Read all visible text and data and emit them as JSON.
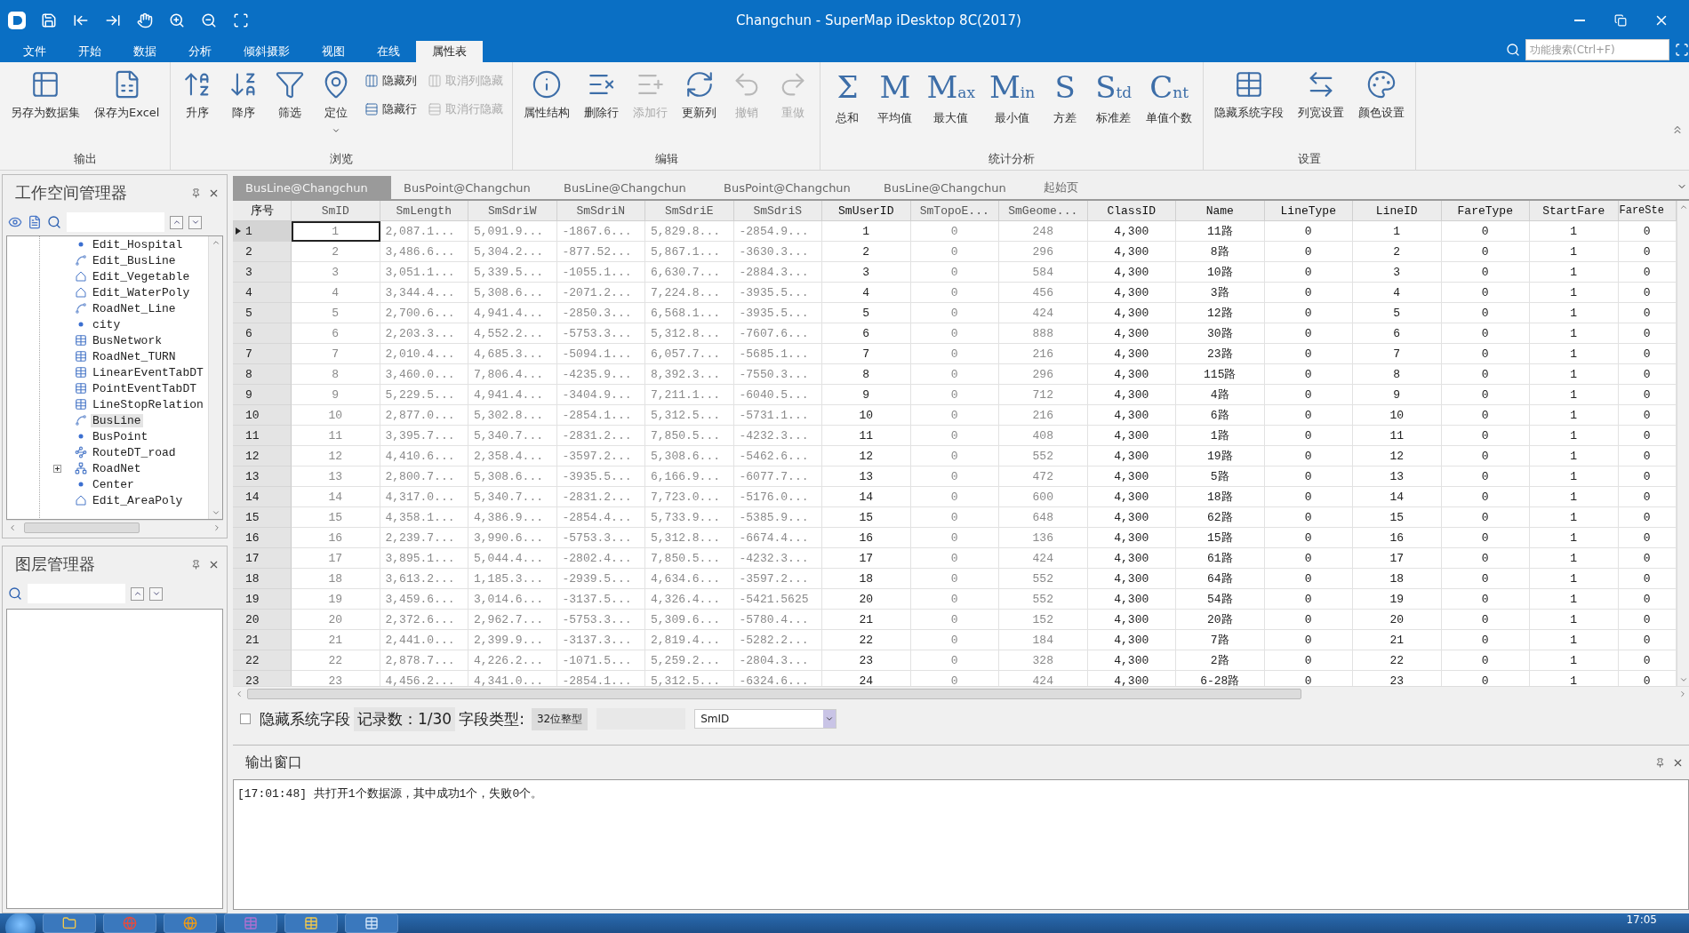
{
  "title_bar": {
    "title": "Changchun - SuperMap iDesktop 8C(2017)"
  },
  "menu_tabs": [
    {
      "label": "文件",
      "selected": false
    },
    {
      "label": "开始",
      "selected": false
    },
    {
      "label": "数据",
      "selected": false
    },
    {
      "label": "分析",
      "selected": false
    },
    {
      "label": "倾斜摄影",
      "selected": false
    },
    {
      "label": "视图",
      "selected": false
    },
    {
      "label": "在线",
      "selected": false
    },
    {
      "label": "属性表",
      "selected": true
    }
  ],
  "search": {
    "placeholder": "功能搜索(Ctrl+F)"
  },
  "ribbon": {
    "groups": [
      {
        "title": "输出",
        "buttons": [
          {
            "kind": "large",
            "label": "另存为数据集",
            "disabled": false
          },
          {
            "kind": "large",
            "label": "保存为Excel",
            "disabled": false
          }
        ]
      },
      {
        "title": "浏览",
        "buttons": [
          {
            "kind": "large",
            "label": "升序",
            "disabled": false
          },
          {
            "kind": "large",
            "label": "降序",
            "disabled": false
          },
          {
            "kind": "large",
            "label": "筛选",
            "disabled": false
          },
          {
            "kind": "large",
            "label": "定位",
            "disabled": false,
            "dropdown": true
          },
          {
            "kind": "small",
            "label": "隐藏列",
            "disabled": false
          },
          {
            "kind": "small",
            "label": "隐藏行",
            "disabled": false
          },
          {
            "kind": "small",
            "label": "取消列隐藏",
            "disabled": true
          },
          {
            "kind": "small",
            "label": "取消行隐藏",
            "disabled": true
          }
        ]
      },
      {
        "title": "编辑",
        "buttons": [
          {
            "kind": "large",
            "label": "属性结构",
            "disabled": false
          },
          {
            "kind": "large",
            "label": "删除行",
            "disabled": false
          },
          {
            "kind": "large",
            "label": "添加行",
            "disabled": true
          },
          {
            "kind": "large",
            "label": "更新列",
            "disabled": false
          },
          {
            "kind": "large",
            "label": "撤销",
            "disabled": true
          },
          {
            "kind": "large",
            "label": "重做",
            "disabled": true
          }
        ]
      },
      {
        "title": "统计分析",
        "buttons": [
          {
            "kind": "stat",
            "glyph": "Σ",
            "label": "总和",
            "disabled": false
          },
          {
            "kind": "stat",
            "glyph": "M",
            "label": "平均值",
            "disabled": false
          },
          {
            "kind": "stat",
            "glyph": "M",
            "sub": "ax",
            "label": "最大值",
            "disabled": false
          },
          {
            "kind": "stat",
            "glyph": "M",
            "sub": "in",
            "label": "最小值",
            "disabled": false
          },
          {
            "kind": "stat",
            "glyph": "S",
            "label": "方差",
            "disabled": false
          },
          {
            "kind": "stat",
            "glyph": "S",
            "sub": "td",
            "label": "标准差",
            "disabled": false
          },
          {
            "kind": "stat",
            "glyph": "C",
            "sub": "nt",
            "label": "单值个数",
            "disabled": false
          }
        ]
      },
      {
        "title": "设置",
        "buttons": [
          {
            "kind": "large",
            "label": "隐藏系统字段",
            "disabled": false
          },
          {
            "kind": "large",
            "label": "列宽设置",
            "disabled": false
          },
          {
            "kind": "large",
            "label": "颜色设置",
            "disabled": false
          }
        ]
      }
    ]
  },
  "workspace": {
    "title": "工作空间管理器",
    "tree": [
      {
        "label": "Edit_Hospital",
        "kind": "point",
        "selected": false
      },
      {
        "label": "Edit_BusLine",
        "kind": "line",
        "selected": false
      },
      {
        "label": "Edit_Vegetable",
        "kind": "region",
        "selected": false
      },
      {
        "label": "Edit_WaterPoly",
        "kind": "region",
        "selected": false
      },
      {
        "label": "RoadNet_Line",
        "kind": "line",
        "selected": false
      },
      {
        "label": "city",
        "kind": "point",
        "selected": false
      },
      {
        "label": "BusNetwork",
        "kind": "table",
        "selected": false
      },
      {
        "label": "RoadNet_TURN",
        "kind": "table",
        "selected": false
      },
      {
        "label": "LinearEventTabDT",
        "kind": "table",
        "selected": false
      },
      {
        "label": "PointEventTabDT",
        "kind": "table",
        "selected": false
      },
      {
        "label": "LineStopRelation",
        "kind": "table",
        "selected": false
      },
      {
        "label": "BusLine",
        "kind": "line",
        "selected": true
      },
      {
        "label": "BusPoint",
        "kind": "point",
        "selected": false
      },
      {
        "label": "RouteDT_road",
        "kind": "route",
        "selected": false
      },
      {
        "label": "RoadNet",
        "kind": "network",
        "selected": false,
        "expanded": false
      },
      {
        "label": "Center",
        "kind": "point",
        "selected": false
      },
      {
        "label": "Edit_AreaPoly",
        "kind": "region",
        "selected": false
      }
    ]
  },
  "layers": {
    "title": "图层管理器"
  },
  "doc_tabs": [
    {
      "label": "BusLine@Changchun",
      "selected": true
    },
    {
      "label": "BusPoint@Changchun",
      "selected": false
    },
    {
      "label": "BusLine@Changchun",
      "selected": false
    },
    {
      "label": "BusPoint@Changchun",
      "selected": false
    },
    {
      "label": "BusLine@Changchun",
      "selected": false
    },
    {
      "label": "起始页",
      "selected": false
    }
  ],
  "table": {
    "columns": [
      {
        "label": "序号"
      },
      {
        "label": "SmID",
        "system": true
      },
      {
        "label": "SmLength",
        "system": true
      },
      {
        "label": "SmSdriW",
        "system": true
      },
      {
        "label": "SmSdriN",
        "system": true
      },
      {
        "label": "SmSdriE",
        "system": true
      },
      {
        "label": "SmSdriS",
        "system": true
      },
      {
        "label": "SmUserID",
        "system": false
      },
      {
        "label": "SmTopoE...",
        "system": true
      },
      {
        "label": "SmGeome...",
        "system": true
      },
      {
        "label": "ClassID",
        "system": false
      },
      {
        "label": "Name",
        "system": false
      },
      {
        "label": "LineType",
        "system": false
      },
      {
        "label": "LineID",
        "system": false
      },
      {
        "label": "FareType",
        "system": false
      },
      {
        "label": "StartFare",
        "system": false
      },
      {
        "label": "FareSte",
        "system": false
      }
    ],
    "rows": [
      {
        "selected": true,
        "cells": [
          "1",
          "1",
          "2,087.1...",
          "5,091.9...",
          "-1867.6...",
          "5,829.8...",
          "-2854.9...",
          "1",
          "0",
          "248",
          "4,300",
          "11路",
          "0",
          "1",
          "0",
          "1",
          "0"
        ]
      },
      {
        "selected": false,
        "cells": [
          "2",
          "2",
          "3,486.6...",
          "5,304.2...",
          "-877.52...",
          "5,867.1...",
          "-3630.3...",
          "2",
          "0",
          "296",
          "4,300",
          "8路",
          "0",
          "2",
          "0",
          "1",
          "0"
        ]
      },
      {
        "selected": false,
        "cells": [
          "3",
          "3",
          "3,051.1...",
          "5,339.5...",
          "-1055.1...",
          "6,630.7...",
          "-2884.3...",
          "3",
          "0",
          "584",
          "4,300",
          "10路",
          "0",
          "3",
          "0",
          "1",
          "0"
        ]
      },
      {
        "selected": false,
        "cells": [
          "4",
          "4",
          "3,344.4...",
          "5,308.6...",
          "-2071.2...",
          "7,224.8...",
          "-3935.5...",
          "4",
          "0",
          "456",
          "4,300",
          "3路",
          "0",
          "4",
          "0",
          "1",
          "0"
        ]
      },
      {
        "selected": false,
        "cells": [
          "5",
          "5",
          "2,700.6...",
          "4,941.4...",
          "-2850.3...",
          "6,568.1...",
          "-3935.5...",
          "5",
          "0",
          "424",
          "4,300",
          "12路",
          "0",
          "5",
          "0",
          "1",
          "0"
        ]
      },
      {
        "selected": false,
        "cells": [
          "6",
          "6",
          "2,203.3...",
          "4,552.2...",
          "-5753.3...",
          "5,312.8...",
          "-7607.6...",
          "6",
          "0",
          "888",
          "4,300",
          "30路",
          "0",
          "6",
          "0",
          "1",
          "0"
        ]
      },
      {
        "selected": false,
        "cells": [
          "7",
          "7",
          "2,010.4...",
          "4,685.3...",
          "-5094.1...",
          "6,057.7...",
          "-5685.1...",
          "7",
          "0",
          "216",
          "4,300",
          "23路",
          "0",
          "7",
          "0",
          "1",
          "0"
        ]
      },
      {
        "selected": false,
        "cells": [
          "8",
          "8",
          "3,460.0...",
          "7,806.4...",
          "-4235.9...",
          "8,392.3...",
          "-7550.3...",
          "8",
          "0",
          "296",
          "4,300",
          "115路",
          "0",
          "8",
          "0",
          "1",
          "0"
        ]
      },
      {
        "selected": false,
        "cells": [
          "9",
          "9",
          "5,229.5...",
          "4,941.4...",
          "-3404.9...",
          "7,211.1...",
          "-6040.5...",
          "9",
          "0",
          "712",
          "4,300",
          "4路",
          "0",
          "9",
          "0",
          "1",
          "0"
        ]
      },
      {
        "selected": false,
        "cells": [
          "10",
          "10",
          "2,877.0...",
          "5,302.8...",
          "-2854.1...",
          "5,312.5...",
          "-5731.1...",
          "10",
          "0",
          "216",
          "4,300",
          "6路",
          "0",
          "10",
          "0",
          "1",
          "0"
        ]
      },
      {
        "selected": false,
        "cells": [
          "11",
          "11",
          "3,395.7...",
          "5,340.7...",
          "-2831.2...",
          "7,850.5...",
          "-4232.3...",
          "11",
          "0",
          "408",
          "4,300",
          "1路",
          "0",
          "11",
          "0",
          "1",
          "0"
        ]
      },
      {
        "selected": false,
        "cells": [
          "12",
          "12",
          "4,410.6...",
          "2,358.4...",
          "-3597.2...",
          "5,308.6...",
          "-5462.6...",
          "12",
          "0",
          "552",
          "4,300",
          "19路",
          "0",
          "12",
          "0",
          "1",
          "0"
        ]
      },
      {
        "selected": false,
        "cells": [
          "13",
          "13",
          "2,800.7...",
          "5,308.6...",
          "-3935.5...",
          "6,166.9...",
          "-6077.7...",
          "13",
          "0",
          "472",
          "4,300",
          "5路",
          "0",
          "13",
          "0",
          "1",
          "0"
        ]
      },
      {
        "selected": false,
        "cells": [
          "14",
          "14",
          "4,317.0...",
          "5,340.7...",
          "-2831.2...",
          "7,723.0...",
          "-5176.0...",
          "14",
          "0",
          "600",
          "4,300",
          "18路",
          "0",
          "14",
          "0",
          "1",
          "0"
        ]
      },
      {
        "selected": false,
        "cells": [
          "15",
          "15",
          "4,358.1...",
          "4,386.9...",
          "-2854.4...",
          "5,733.9...",
          "-5385.9...",
          "15",
          "0",
          "648",
          "4,300",
          "62路",
          "0",
          "15",
          "0",
          "1",
          "0"
        ]
      },
      {
        "selected": false,
        "cells": [
          "16",
          "16",
          "2,239.7...",
          "3,990.6...",
          "-5753.3...",
          "5,312.8...",
          "-6674.4...",
          "16",
          "0",
          "136",
          "4,300",
          "15路",
          "0",
          "16",
          "0",
          "1",
          "0"
        ]
      },
      {
        "selected": false,
        "cells": [
          "17",
          "17",
          "3,895.1...",
          "5,044.4...",
          "-2802.4...",
          "7,850.5...",
          "-4232.3...",
          "17",
          "0",
          "424",
          "4,300",
          "61路",
          "0",
          "17",
          "0",
          "1",
          "0"
        ]
      },
      {
        "selected": false,
        "cells": [
          "18",
          "18",
          "3,613.2...",
          "1,185.3...",
          "-2939.5...",
          "4,634.6...",
          "-3597.2...",
          "18",
          "0",
          "552",
          "4,300",
          "64路",
          "0",
          "18",
          "0",
          "1",
          "0"
        ]
      },
      {
        "selected": false,
        "cells": [
          "19",
          "19",
          "3,459.6...",
          "3,014.6...",
          "-3137.5...",
          "4,326.4...",
          "-5421.5625",
          "20",
          "0",
          "552",
          "4,300",
          "54路",
          "0",
          "19",
          "0",
          "1",
          "0"
        ]
      },
      {
        "selected": false,
        "cells": [
          "20",
          "20",
          "2,372.6...",
          "2,962.7...",
          "-5753.3...",
          "5,309.6...",
          "-5780.4...",
          "21",
          "0",
          "152",
          "4,300",
          "20路",
          "0",
          "20",
          "0",
          "1",
          "0"
        ]
      },
      {
        "selected": false,
        "cells": [
          "21",
          "21",
          "2,441.0...",
          "2,399.9...",
          "-3137.3...",
          "2,819.4...",
          "-5282.2...",
          "22",
          "0",
          "184",
          "4,300",
          "7路",
          "0",
          "21",
          "0",
          "1",
          "0"
        ]
      },
      {
        "selected": false,
        "cells": [
          "22",
          "22",
          "2,878.7...",
          "4,226.2...",
          "-1071.5...",
          "5,259.2...",
          "-2804.3...",
          "23",
          "0",
          "328",
          "4,300",
          "2路",
          "0",
          "22",
          "0",
          "1",
          "0"
        ]
      },
      {
        "selected": false,
        "cells": [
          "23",
          "23",
          "4,456.2...",
          "4,341.0...",
          "-2854.1...",
          "5,312.5...",
          "-6324.6...",
          "24",
          "0",
          "424",
          "4,300",
          "6-28路",
          "0",
          "23",
          "0",
          "1",
          "0"
        ]
      }
    ]
  },
  "footer": {
    "hide_system_fields": {
      "label": "隐藏系统字段",
      "checked": false
    },
    "record_count": "记录数：1/30",
    "field_type_label": "字段类型:",
    "field_type": "32位整型",
    "field_select": "SmID"
  },
  "output": {
    "title": "输出窗口",
    "lines": [
      "[17:01:48] 共打开1个数据源，其中成功1个，失败0个。"
    ]
  },
  "taskbar": {
    "time": "17:05"
  }
}
